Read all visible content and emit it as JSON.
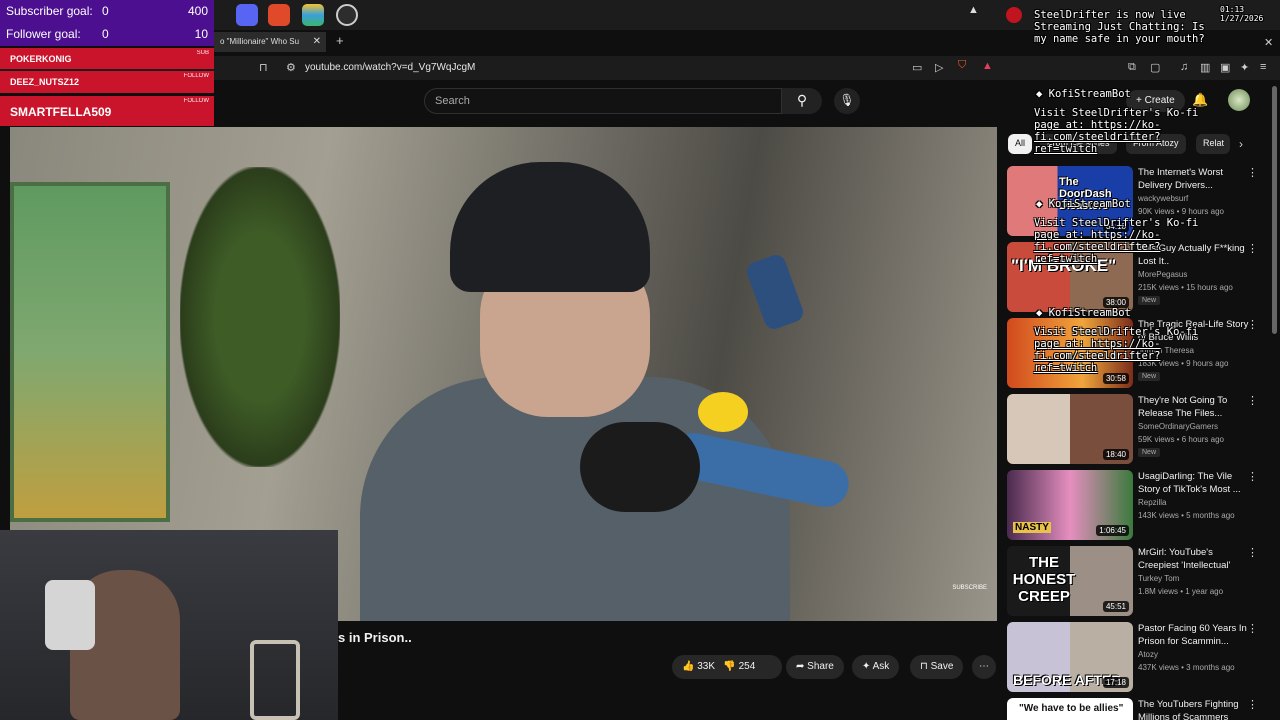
{
  "overlay": {
    "subscriber_goal": {
      "label": "Subscriber goal:",
      "current": "0",
      "target": "400"
    },
    "follower_goal": {
      "label": "Follower goal:",
      "current": "0",
      "target": "10"
    },
    "alerts": [
      {
        "name": "POKERKONIG",
        "tag": "SUB"
      },
      {
        "name": "DEEZ_NUTSZ12",
        "tag": "FOLLOW"
      },
      {
        "name": "SMARTFELLA509",
        "tag": "FOLLOW"
      }
    ],
    "status_lines": [
      "SteelDrifter is now live",
      "Streaming Just Chatting: Is",
      "my name safe in your mouth?"
    ],
    "kofi_bot": "KofiStreamBot",
    "kofi_lines": [
      "Visit SteelDrifter's Ko-fi",
      "page at: https://ko-",
      "fi.com/steeldrifter?",
      "ref=twitch"
    ]
  },
  "browser": {
    "tab_title": "o \"Millionaire\" Who Su",
    "url": "youtube.com/watch?v=d_Vg7WqJcgM",
    "time": "01:13",
    "date": "1/27/2026"
  },
  "youtube": {
    "search_placeholder": "Search",
    "create_label": "Create",
    "title_fragment": "s in Prison..",
    "likes": "33K",
    "dislikes": "254",
    "share": "Share",
    "ask": "Ask",
    "save": "Save",
    "subscribe_watermark": "SUBSCRIBE",
    "chips": [
      "All",
      "From the series",
      "From Atozy",
      "Relat"
    ]
  },
  "recommendations": [
    {
      "title": "The Internet's Worst Delivery Drivers...",
      "channel": "wackywebsurf",
      "meta": "90K views • 9 hours ago",
      "duration": "34:18",
      "new": "New",
      "thumb_text": "The DoorDash Disasters"
    },
    {
      "title": "This Guy Actually F**king Lost It..",
      "channel": "MorePegasus",
      "meta": "215K views • 15 hours ago",
      "duration": "38:00",
      "new": "New",
      "thumb_text": "\"I'M BROKE\""
    },
    {
      "title": "The Tragic Real-Life Story of Bruce Willis",
      "channel": "Jordan Theresa",
      "meta": "183K views • 9 hours ago",
      "duration": "30:58",
      "new": "New",
      "thumb_text": ""
    },
    {
      "title": "They're Not Going To Release The Files...",
      "channel": "SomeOrdinaryGamers",
      "meta": "59K views • 6 hours ago",
      "duration": "18:40",
      "new": "New",
      "thumb_text": ""
    },
    {
      "title": "UsagiDarling: The Vile Story of TikTok's Most ...",
      "channel": "Repzilla",
      "meta": "143K views • 5 months ago",
      "duration": "1:06:45",
      "new": "",
      "thumb_text": "NASTY"
    },
    {
      "title": "MrGirl: YouTube's Creepiest 'Intellectual'",
      "channel": "Turkey Tom",
      "meta": "1.8M views • 1 year ago",
      "duration": "45:51",
      "new": "",
      "thumb_text": "THE HONEST CREEP"
    },
    {
      "title": "Pastor Facing 60 Years In Prison for Scammin...",
      "channel": "Atozy",
      "meta": "437K views • 3 months ago",
      "duration": "17:18",
      "new": "",
      "thumb_text": "BEFORE   AFTER"
    },
    {
      "title": "The YouTubers Fighting Millions of Scammers",
      "channel": "",
      "meta": "",
      "duration": "",
      "new": "",
      "thumb_text": "\"We have to be allies\""
    }
  ]
}
